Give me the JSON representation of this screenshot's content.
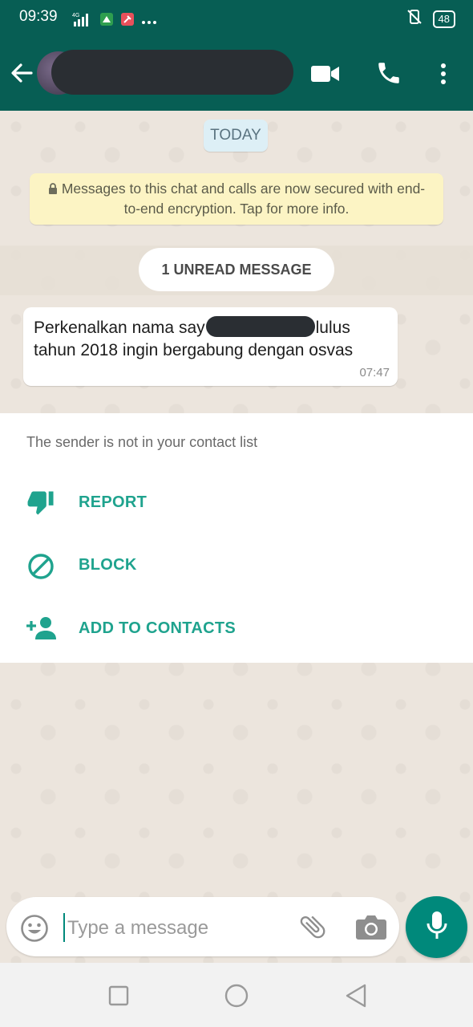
{
  "status_bar": {
    "time": "09:39",
    "network": "4G",
    "battery": "48",
    "icons": [
      "signal-icon",
      "app-notification-icon",
      "pinned-app-icon",
      "more-dots-icon",
      "vibrate-icon",
      "battery-icon"
    ]
  },
  "app_bar": {
    "icons": [
      "back-arrow-icon",
      "avatar",
      "video-call-icon",
      "voice-call-icon",
      "more-vert-icon"
    ]
  },
  "chat": {
    "date_label": "TODAY",
    "encryption_notice": "Messages to this chat and calls are now secured with end-to-end encryption. Tap for more info.",
    "unread_label": "1 UNREAD MESSAGE",
    "message": {
      "text_before": "Perkenalkan nama say",
      "text_after": "lulus tahun 2018 ingin bergabung dengan osvas",
      "time": "07:47"
    }
  },
  "sender_panel": {
    "note": "The sender is not in your contact list",
    "actions": [
      {
        "label": "REPORT",
        "icon": "thumbs-down-icon"
      },
      {
        "label": "BLOCK",
        "icon": "block-icon"
      },
      {
        "label": "ADD TO CONTACTS",
        "icon": "add-person-icon"
      }
    ]
  },
  "composer": {
    "placeholder": "Type a message",
    "icons": [
      "emoji-icon",
      "attach-icon",
      "camera-icon",
      "mic-icon"
    ]
  },
  "colors": {
    "header": "#075E54",
    "accent": "#1FA38E",
    "mic_button": "#00897B",
    "wallpaper": "#ECE5DD"
  }
}
